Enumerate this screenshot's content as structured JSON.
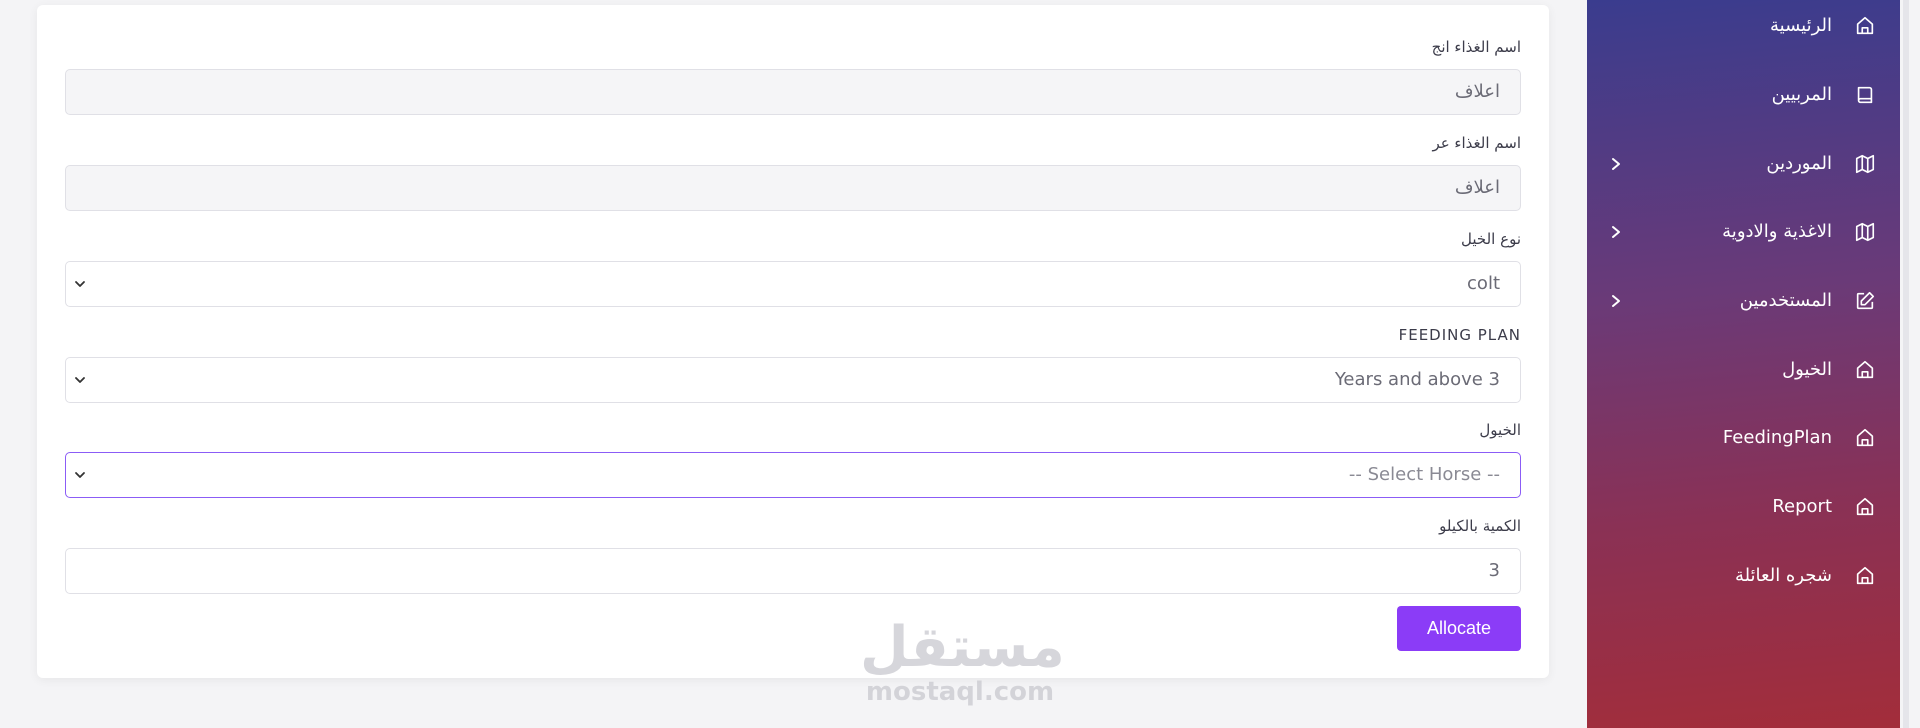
{
  "form": {
    "food_name_en": {
      "label": "اسم الغذاء انج",
      "value": "اعلاف"
    },
    "food_name_ar": {
      "label": "اسم الغذاء عر",
      "value": "اعلاف"
    },
    "horse_type": {
      "label": "نوع الخيل",
      "value": "colt"
    },
    "feeding_plan": {
      "label": "FEEDING PLAN",
      "value": "Years and above 3"
    },
    "horses": {
      "label": "الخيول",
      "placeholder": "-- Select Horse --"
    },
    "quantity": {
      "label": "الكمية بالكيلو",
      "value": "3"
    },
    "submit_label": "Allocate"
  },
  "watermark": {
    "arabic": "مستقل",
    "latin": "mostaql.com"
  },
  "sidebar": {
    "items": [
      {
        "label": "الرئيسية",
        "icon": "home-icon",
        "has_submenu": false
      },
      {
        "label": "المربيين",
        "icon": "book-icon",
        "has_submenu": false
      },
      {
        "label": "الموردين",
        "icon": "map-icon",
        "has_submenu": true
      },
      {
        "label": "الاغذية والادوية",
        "icon": "map-icon",
        "has_submenu": true
      },
      {
        "label": "المستخدمين",
        "icon": "edit-icon",
        "has_submenu": true
      },
      {
        "label": "الخيول",
        "icon": "home-icon",
        "has_submenu": false
      },
      {
        "label": "FeedingPlan",
        "icon": "home-icon",
        "has_submenu": false
      },
      {
        "label": "Report",
        "icon": "home-icon",
        "has_submenu": false
      },
      {
        "label": "شجره العائلة",
        "icon": "home-icon",
        "has_submenu": false
      }
    ]
  },
  "colors": {
    "accent": "#8b3cf7",
    "focus_border": "#8b5cf6",
    "sidebar_gradient_top": "#3a3c8e",
    "sidebar_gradient_bottom": "#a32d3a"
  }
}
